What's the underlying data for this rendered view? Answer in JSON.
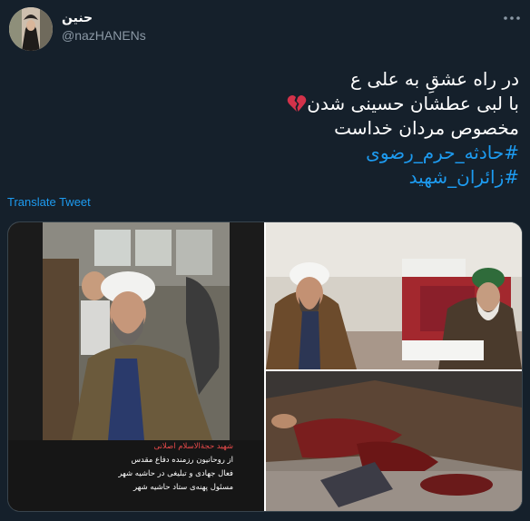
{
  "author": {
    "name": "حنین",
    "handle": "@nazHANENs"
  },
  "tweet": {
    "lines": [
      "در راه عشقِ به علی ع",
      "با لبی عطشان حسینی شدن",
      "مخصوص مردان خداست"
    ],
    "hashtags": [
      "#حادثه_حرم_رضوی",
      "#زائران_شهید"
    ],
    "translate_label": "Translate Tweet"
  },
  "media": {
    "caption": {
      "title": "شهید حجةالاسلام اصلانی",
      "lines": [
        "از روحانیون رزمنده دفاع مقدس",
        "فعال جهادی و تبلیغی در حاشیه شهر",
        "مسئول پهنه‌ی ستاد حاشیه شهر"
      ]
    }
  },
  "icons": {
    "more": "more-horizontal-icon",
    "heart": "broken-heart-emoji"
  },
  "colors": {
    "background": "#15202b",
    "link": "#1d9bf0",
    "muted": "#8b98a5",
    "caption_title": "#e84a4a"
  }
}
